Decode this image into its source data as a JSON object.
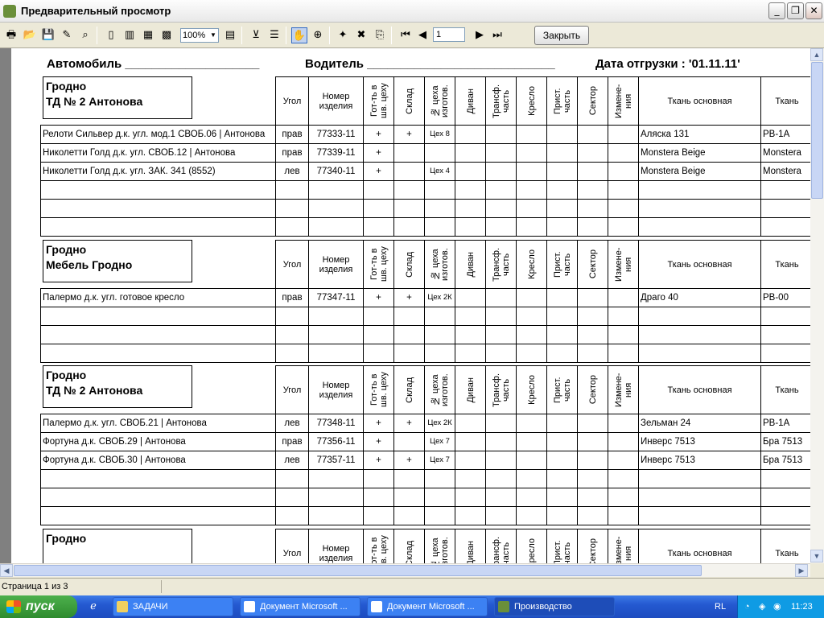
{
  "window": {
    "title": "Предварительный просмотр"
  },
  "toolbar": {
    "zoom": "100%",
    "page_input": "1",
    "close_label": "Закрыть"
  },
  "report": {
    "auto_label": "Автомобиль ____________________",
    "driver_label": "Водитель ____________________________",
    "date_label": "Дата отгрузки : '01.11.11'"
  },
  "columns": {
    "ugol": "Угол",
    "nomer": "Номер изделия",
    "gotov": "Гот-ть в шв. цеху",
    "sklad": "Склад",
    "tseh": "№ цеха изготов.",
    "divan": "Диван",
    "transf": "Трансф. часть",
    "kreslo": "Кресло",
    "prist": "Прист. часть",
    "sektor": "Сектор",
    "izmen": "Измене-ния",
    "tkan": "Ткань основная",
    "tkan2": "Ткань"
  },
  "groups": [
    {
      "line1": "Гродно",
      "line2": "ТД № 2 Антонова",
      "rows": [
        {
          "name": "Релоти Сильвер д.к. угл. мод.1 СВОБ.06 | Антонова",
          "ugol": "прав",
          "nomer": "77333-11",
          "gotov": "+",
          "sklad": "+",
          "tseh": "Цех 8",
          "tkan": "Аляска 131",
          "tkan2": "РВ-1А"
        },
        {
          "name": "Николетти Голд д.к. угл. СВОБ.12 | Антонова",
          "ugol": "прав",
          "nomer": "77339-11",
          "gotov": "+",
          "sklad": "",
          "tseh": "",
          "tkan": "Monstera Beige",
          "tkan2": "Monstera"
        },
        {
          "name": "Николетти Голд д.к. угл. ЗАК. 341 (8552)",
          "ugol": "лев",
          "nomer": "77340-11",
          "gotov": "+",
          "sklad": "",
          "tseh": "Цех 4",
          "tkan": "Monstera Beige",
          "tkan2": "Monstera"
        }
      ]
    },
    {
      "line1": "Гродно",
      "line2": "Мебель Гродно",
      "rows": [
        {
          "name": "Палермо д.к. угл. готовое кресло",
          "ugol": "прав",
          "nomer": "77347-11",
          "gotov": "+",
          "sklad": "+",
          "tseh": "Цех 2К",
          "tkan": "Драго 40",
          "tkan2": "РВ-00"
        }
      ]
    },
    {
      "line1": "Гродно",
      "line2": "ТД № 2 Антонова",
      "rows": [
        {
          "name": "Палермо д.к. угл. СВОБ.21 | Антонова",
          "ugol": "лев",
          "nomer": "77348-11",
          "gotov": "+",
          "sklad": "+",
          "tseh": "Цех 2К",
          "tkan": "Зельман 24",
          "tkan2": "РВ-1А"
        },
        {
          "name": "Фортуна д.к. СВОБ.29 | Антонова",
          "ugol": "прав",
          "nomer": "77356-11",
          "gotov": "+",
          "sklad": "",
          "tseh": "Цех 7",
          "tkan": "Инверс 7513",
          "tkan2": "Бра 7513"
        },
        {
          "name": "Фортуна д.к. СВОБ.30 | Антонова",
          "ugol": "лев",
          "nomer": "77357-11",
          "gotov": "+",
          "sklad": "+",
          "tseh": "Цех 7",
          "tkan": "Инверс 7513",
          "tkan2": "Бра 7513"
        }
      ]
    },
    {
      "line1": "Гродно",
      "line2": "",
      "rows": []
    }
  ],
  "status": {
    "page": "Страница 1 из 3"
  },
  "taskbar": {
    "start": "пуск",
    "tasks": [
      "ЗАДАЧИ",
      "Документ Microsoft ...",
      "Документ Microsoft ...",
      "Производство"
    ],
    "lang": "RL",
    "clock": "11:23"
  }
}
